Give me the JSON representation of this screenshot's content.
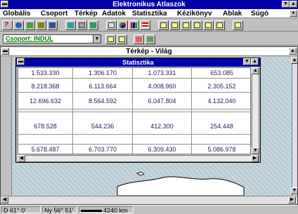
{
  "app": {
    "title": "Elektronikus Atlaszok"
  },
  "menu": {
    "items": [
      "Globális",
      "Csoport",
      "Térkép",
      "Adatok",
      "Statisztika",
      "Kézikönyv",
      "Ablak",
      "Súgó"
    ]
  },
  "toolbar": {
    "icons": [
      "help-icon",
      "globe-icon",
      "map-icon",
      "map2-icon",
      "book-icon",
      "layers-icon",
      "grid-icon",
      "layers2-icon",
      "table-icon",
      "pie-chart-icon",
      "bar-chart-icon",
      "bars-icon",
      "doc-icon",
      "doc2-icon",
      "doc3-icon",
      "doc4-icon",
      "doc5-icon",
      "doc6-icon",
      "doc7-icon"
    ]
  },
  "group": {
    "label": "Csoport: INDUL"
  },
  "map_window": {
    "title": "Térkép - Világ"
  },
  "stat_window": {
    "title": "Statisztika",
    "rows": [
      [
        "1.533.330",
        "1.306.170",
        "1.073.331",
        "653.085"
      ],
      [
        "8.218.368",
        "6.113.664",
        "4.008.960",
        "2.305.152"
      ],
      [
        "12.696.632",
        "8.564.592",
        "6.047.804",
        "4.132.040"
      ],
      [
        "",
        "",
        "",
        ""
      ],
      [
        "678.528",
        "544.236",
        "412.300",
        "254.448"
      ],
      [
        "",
        "",
        "",
        ""
      ],
      [
        "5.678.487",
        "6.703.770",
        "6.309.430",
        "5.086.978"
      ]
    ]
  },
  "status": {
    "lon": "D 61° 0'",
    "lat": "Ny 56° 51'",
    "scale": "4240 km"
  },
  "colors": {
    "title_bar": "#0000a8",
    "group_text": "#008000",
    "window_bg": "#c0c0c0"
  }
}
